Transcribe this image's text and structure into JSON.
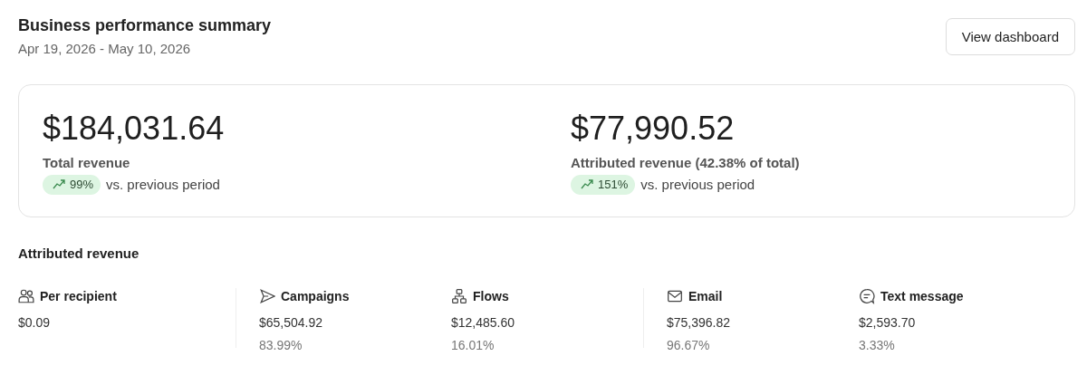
{
  "header": {
    "title": "Business performance summary",
    "date_range": "Apr 19, 2026 - May 10, 2026",
    "button": "View dashboard"
  },
  "summary": [
    {
      "amount": "$184,031.64",
      "label": "Total revenue",
      "change": "99%",
      "comparison": "vs. previous period"
    },
    {
      "amount": "$77,990.52",
      "label": "Attributed revenue (42.38% of total)",
      "change": "151%",
      "comparison": "vs. previous period"
    }
  ],
  "attributed": {
    "title": "Attributed revenue",
    "groups": [
      [
        {
          "kind": "people",
          "label": "Per recipient",
          "value": "$0.09"
        }
      ],
      [
        {
          "kind": "send",
          "label": "Campaigns",
          "value": "$65,504.92",
          "share": "83.99%"
        },
        {
          "kind": "flow",
          "label": "Flows",
          "value": "$12,485.60",
          "share": "16.01%"
        }
      ],
      [
        {
          "kind": "email",
          "label": "Email",
          "value": "$75,396.82",
          "share": "96.67%"
        },
        {
          "kind": "chat",
          "label": "Text message",
          "value": "$2,593.70",
          "share": "3.33%"
        }
      ]
    ]
  }
}
